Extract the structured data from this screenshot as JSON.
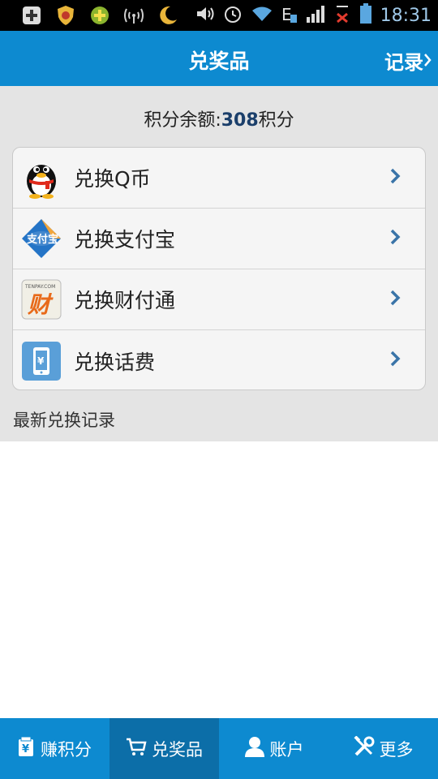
{
  "status_bar": {
    "time": "18:31"
  },
  "header": {
    "title": "兑奖品",
    "records_label": "记录"
  },
  "balance": {
    "prefix": "积分余额:",
    "value": "308",
    "suffix": "积分"
  },
  "exchange_items": [
    {
      "label": "兑换Q币",
      "icon": "qq-penguin-icon"
    },
    {
      "label": "兑换支付宝",
      "icon": "alipay-icon"
    },
    {
      "label": "兑换财付通",
      "icon": "tenpay-icon"
    },
    {
      "label": "兑换话费",
      "icon": "phone-yuan-icon"
    }
  ],
  "recent_section": {
    "title": "最新兑换记录"
  },
  "bottom_nav": [
    {
      "label": "赚积分",
      "icon": "earn-points-icon",
      "active": false
    },
    {
      "label": "兑奖品",
      "icon": "cart-icon",
      "active": true
    },
    {
      "label": "账户",
      "icon": "user-icon",
      "active": false
    },
    {
      "label": "更多",
      "icon": "tools-icon",
      "active": false
    }
  ],
  "colors": {
    "primary": "#0d8ad0",
    "nav_active": "#0c6ea8",
    "background": "#e4e4e4"
  }
}
